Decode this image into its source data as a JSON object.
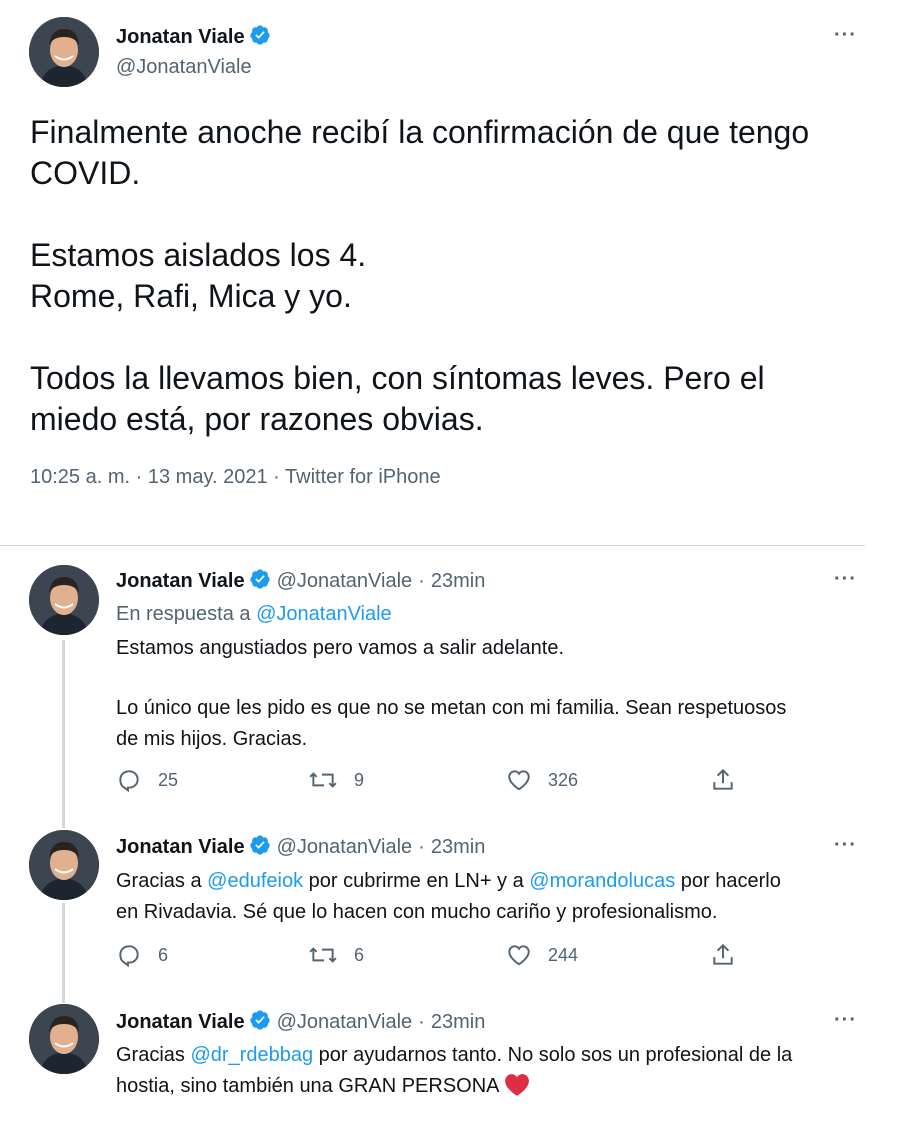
{
  "main_tweet": {
    "author_name": "Jonatan Viale",
    "author_handle": "@JonatanViale",
    "more_label": "···",
    "paragraphs": [
      [
        "Finalmente anoche recibí la confirmación de que tengo",
        "COVID."
      ],
      [
        "Estamos aislados los 4.",
        "Rome, Rafi, Mica y yo."
      ],
      [
        "Todos la llevamos bien, con síntomas leves. Pero el",
        "miedo está, por razones obvias."
      ]
    ],
    "time": "10:25 a. m.",
    "date": "13 may. 2021",
    "source": "Twitter for iPhone",
    "separator": "·"
  },
  "replies": [
    {
      "author_name": "Jonatan Viale",
      "author_handle": "@JonatanViale",
      "age": "23min",
      "in_reply_prefix": "En respuesta a",
      "in_reply_handle": "@JonatanViale",
      "lines": [
        "Estamos angustiados pero vamos a salir adelante.",
        "Lo único que les pido es que no se metan con mi familia. Sean respetuosos",
        "de mis hijos. Gracias."
      ],
      "replies_count": "25",
      "retweets_count": "9",
      "likes_count": "326"
    },
    {
      "author_name": "Jonatan Viale",
      "author_handle": "@JonatanViale",
      "age": "23min",
      "line1": {
        "a": "Gracias a ",
        "m1": "@edufeiok",
        "b": " por cubrirme en LN+ y a ",
        "m2": "@morandolucas",
        "c": " por hacerlo"
      },
      "line2": "en Rivadavia. Sé que lo hacen con mucho cariño y profesionalismo.",
      "replies_count": "6",
      "retweets_count": "6",
      "likes_count": "244"
    },
    {
      "author_name": "Jonatan Viale",
      "author_handle": "@JonatanViale",
      "age": "23min",
      "line1": {
        "a": "Gracias ",
        "m1": "@dr_rdebbag",
        "b": " por ayudarnos tanto. No solo sos un profesional de la"
      },
      "line2": "hostia, sino también una GRAN PERSONA"
    }
  ],
  "icons": {
    "verified": "verified-badge-icon",
    "reply": "reply-icon",
    "retweet": "retweet-icon",
    "like": "heart-icon",
    "share": "share-icon",
    "emoji": "red-heart-emoji-icon"
  },
  "colors": {
    "link": "#1d9bf0",
    "secondary_text": "#536471",
    "divider": "#cfd9de",
    "emoji_heart": "#dd2e44"
  }
}
